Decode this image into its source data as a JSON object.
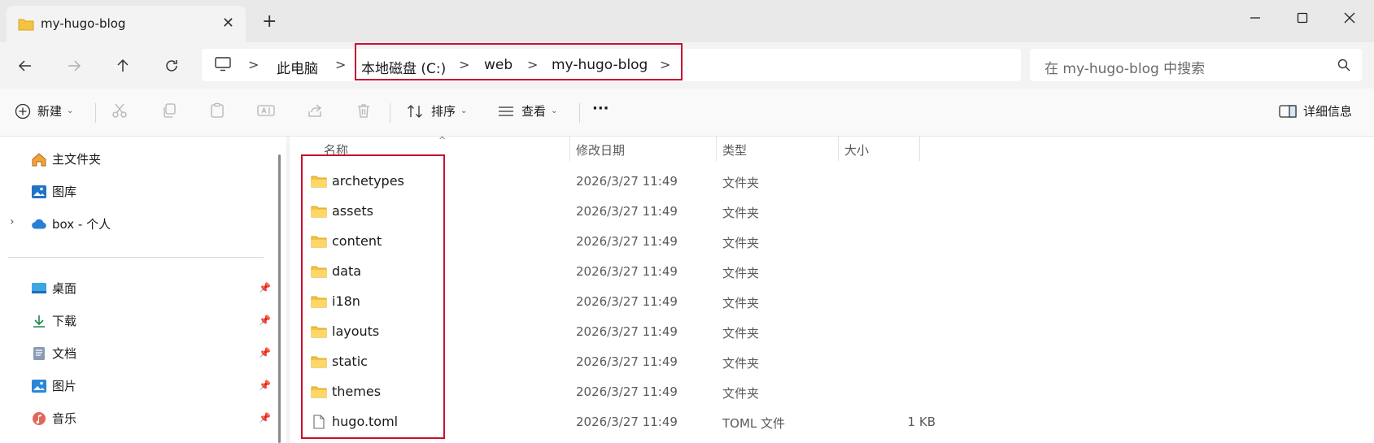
{
  "tab": {
    "title": "my-hugo-blog",
    "close": "✕",
    "new_tab": "+"
  },
  "window": {
    "minimize": "—",
    "maximize": "▢",
    "close": "✕"
  },
  "address": {
    "crumbs": [
      "此电脑",
      "本地磁盘 (C:)",
      "web",
      "my-hugo-blog"
    ],
    "separator": ">"
  },
  "search": {
    "placeholder": "在 my-hugo-blog 中搜索"
  },
  "toolbar": {
    "new_label": "新建",
    "sort_label": "排序",
    "view_label": "查看",
    "more_label": "···",
    "details_label": "详细信息"
  },
  "sidebar": {
    "top_items": [
      {
        "label": "主文件夹",
        "icon": "home-icon"
      },
      {
        "label": "图库",
        "icon": "gallery-icon"
      },
      {
        "label": "box - 个人",
        "icon": "cloud-icon"
      }
    ],
    "quick_access": [
      {
        "label": "桌面",
        "icon": "desktop-icon"
      },
      {
        "label": "下载",
        "icon": "download-icon"
      },
      {
        "label": "文档",
        "icon": "document-icon"
      },
      {
        "label": "图片",
        "icon": "pictures-icon"
      },
      {
        "label": "音乐",
        "icon": "music-icon"
      }
    ]
  },
  "columns": {
    "name": "名称",
    "date": "修改日期",
    "type": "类型",
    "size": "大小"
  },
  "files": [
    {
      "name": "archetypes",
      "date": "2026/3/27 11:49",
      "type": "文件夹",
      "size": "",
      "kind": "folder"
    },
    {
      "name": "assets",
      "date": "2026/3/27 11:49",
      "type": "文件夹",
      "size": "",
      "kind": "folder"
    },
    {
      "name": "content",
      "date": "2026/3/27 11:49",
      "type": "文件夹",
      "size": "",
      "kind": "folder"
    },
    {
      "name": "data",
      "date": "2026/3/27 11:49",
      "type": "文件夹",
      "size": "",
      "kind": "folder"
    },
    {
      "name": "i18n",
      "date": "2026/3/27 11:49",
      "type": "文件夹",
      "size": "",
      "kind": "folder"
    },
    {
      "name": "layouts",
      "date": "2026/3/27 11:49",
      "type": "文件夹",
      "size": "",
      "kind": "folder"
    },
    {
      "name": "static",
      "date": "2026/3/27 11:49",
      "type": "文件夹",
      "size": "",
      "kind": "folder"
    },
    {
      "name": "themes",
      "date": "2026/3/27 11:49",
      "type": "文件夹",
      "size": "",
      "kind": "folder"
    },
    {
      "name": "hugo.toml",
      "date": "2026/3/27 11:49",
      "type": "TOML 文件",
      "size": "1 KB",
      "kind": "file"
    }
  ],
  "colors": {
    "accent": "#0067c0",
    "folder": "#f5c342",
    "highlight": "#c8102e"
  }
}
